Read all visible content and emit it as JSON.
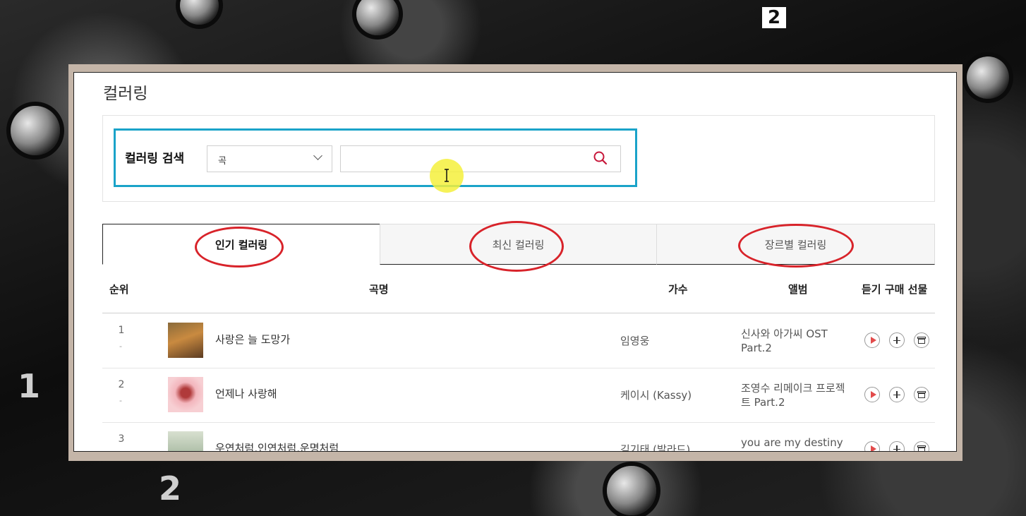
{
  "page": {
    "title": "컬러링"
  },
  "search": {
    "label": "컬러링 검색",
    "select_value": "곡",
    "input_value": "",
    "input_placeholder": ""
  },
  "tabs": [
    {
      "label": "인기 컬러링",
      "active": true
    },
    {
      "label": "최신 컬러링",
      "active": false
    },
    {
      "label": "장르별 컬러링",
      "active": false
    }
  ],
  "table": {
    "headers": {
      "rank": "순위",
      "title": "곡명",
      "artist": "가수",
      "album": "앨범",
      "actions": "듣기 구매 선물"
    },
    "rows": [
      {
        "rank": "1",
        "change": "-",
        "title": "사랑은 늘 도망가",
        "artist": "임영웅",
        "album": "신사와 아가씨 OST Part.2"
      },
      {
        "rank": "2",
        "change": "-",
        "title": "언제나 사랑해",
        "artist": "케이시 (Kassy)",
        "album": "조영수 리메이크 프로젝트 Part.2"
      },
      {
        "rank": "3",
        "change": "",
        "title": "우연처럼,인연처럼,운명처럼",
        "artist": "김기태 (발라드)",
        "album": "you are my destiny"
      }
    ]
  },
  "icons": {
    "search": "search-icon",
    "dropdown": "chevron-down-icon",
    "play": "play-icon",
    "add": "plus-icon",
    "gift": "gift-icon"
  },
  "colors": {
    "highlight_border": "#1aa3c9",
    "annotation": "#d8232a",
    "search_icon": "#c7173a",
    "play_icon": "#e24b4b",
    "frame": "#c4b5a8"
  },
  "background_digits": [
    "2",
    "1",
    "2"
  ]
}
